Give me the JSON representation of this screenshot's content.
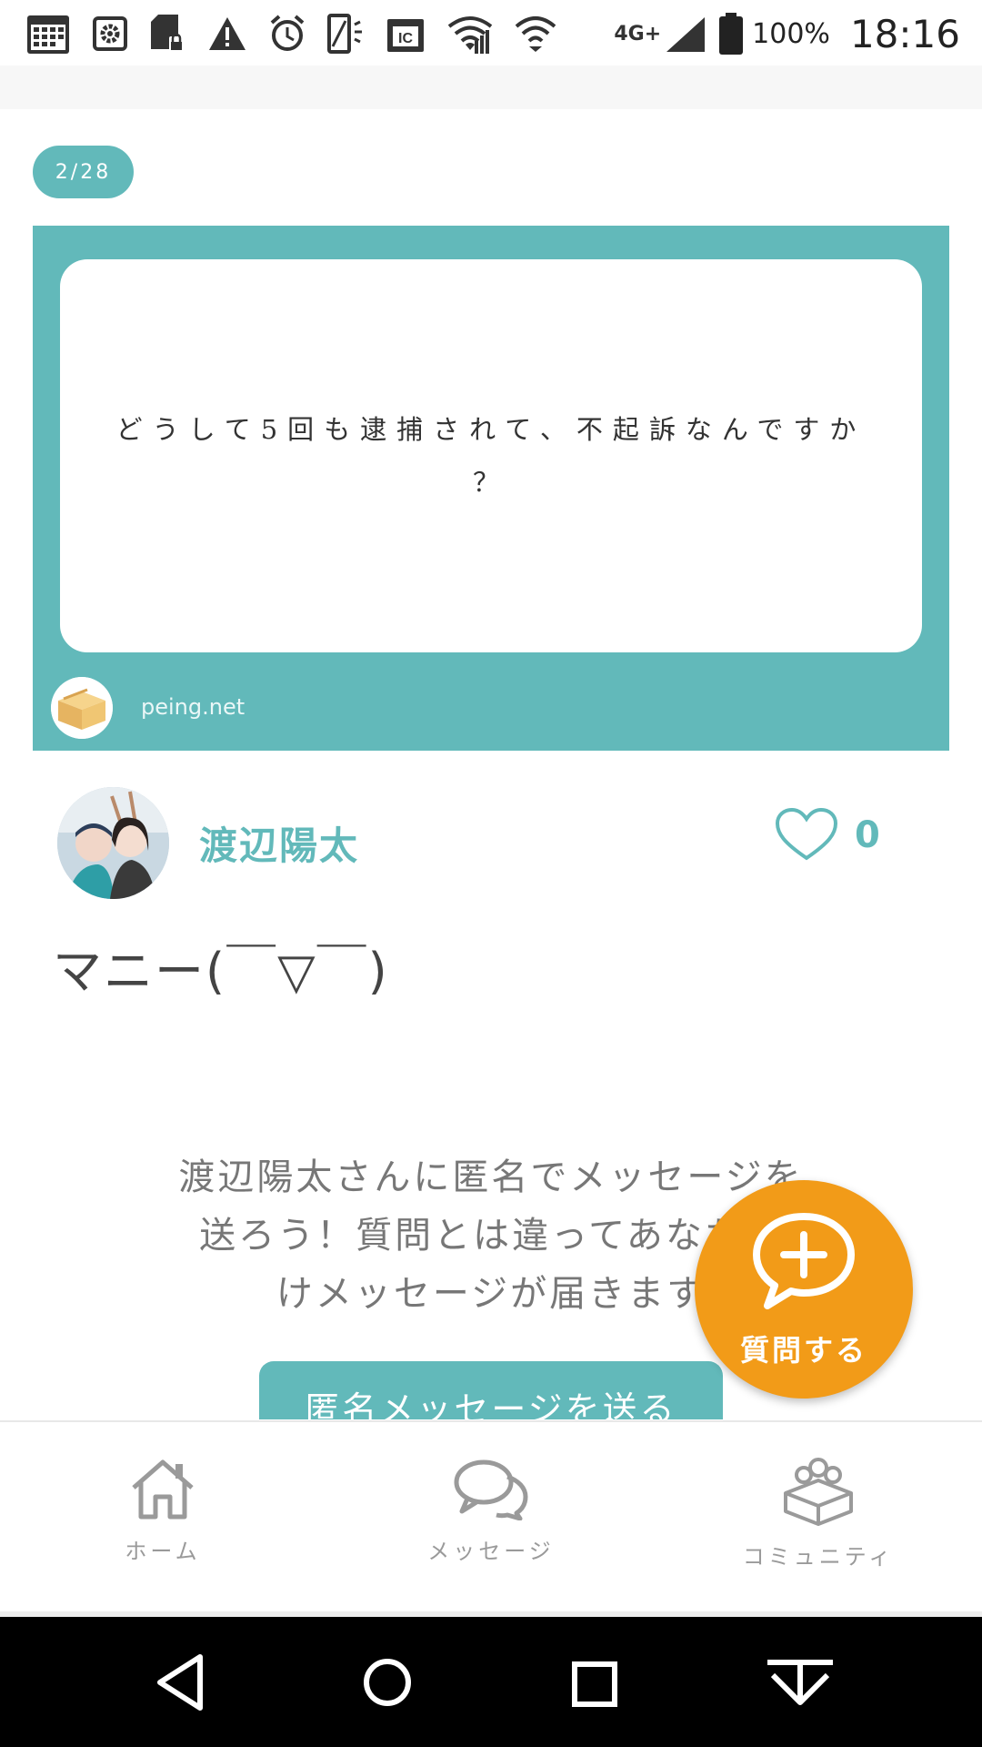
{
  "status_bar": {
    "icons": [
      "calendar-icon",
      "settings-icon",
      "sd-card-icon",
      "warning-icon",
      "alarm-icon",
      "nfc-icon",
      "ic-card-icon",
      "wifi-icon",
      "wifi-icon",
      "lte-icon",
      "signal-icon",
      "battery-icon"
    ],
    "network_label": "4G+",
    "battery_percent": "100%",
    "time": "18:16"
  },
  "counter": "2/28",
  "question": {
    "text_line1": "どうして5回も逮捕されて、不起訴なんですか",
    "text_line2": "？",
    "site": "peing.net",
    "logo_icon": "box-icon"
  },
  "answer": {
    "username": "渡辺陽太",
    "like_count": "0",
    "text": "マニー(￣▽￣)"
  },
  "anon_message": {
    "line1": "渡辺陽太さんに匿名でメッセージを",
    "line2": "送ろう！質問とは違ってあなただ",
    "line3": "けメッセージが届きます",
    "button_label": "匿名メッセージを送る"
  },
  "fab": {
    "label": "質問する",
    "icon": "add-chat-icon"
  },
  "bottom_nav": [
    {
      "label": "ホーム",
      "icon": "home-icon"
    },
    {
      "label": "メッセージ",
      "icon": "chat-icon"
    },
    {
      "label": "コミュニティ",
      "icon": "community-icon"
    }
  ],
  "colors": {
    "teal": "#62b9ba",
    "orange": "#f29b18",
    "gray": "#9a9a9a"
  }
}
